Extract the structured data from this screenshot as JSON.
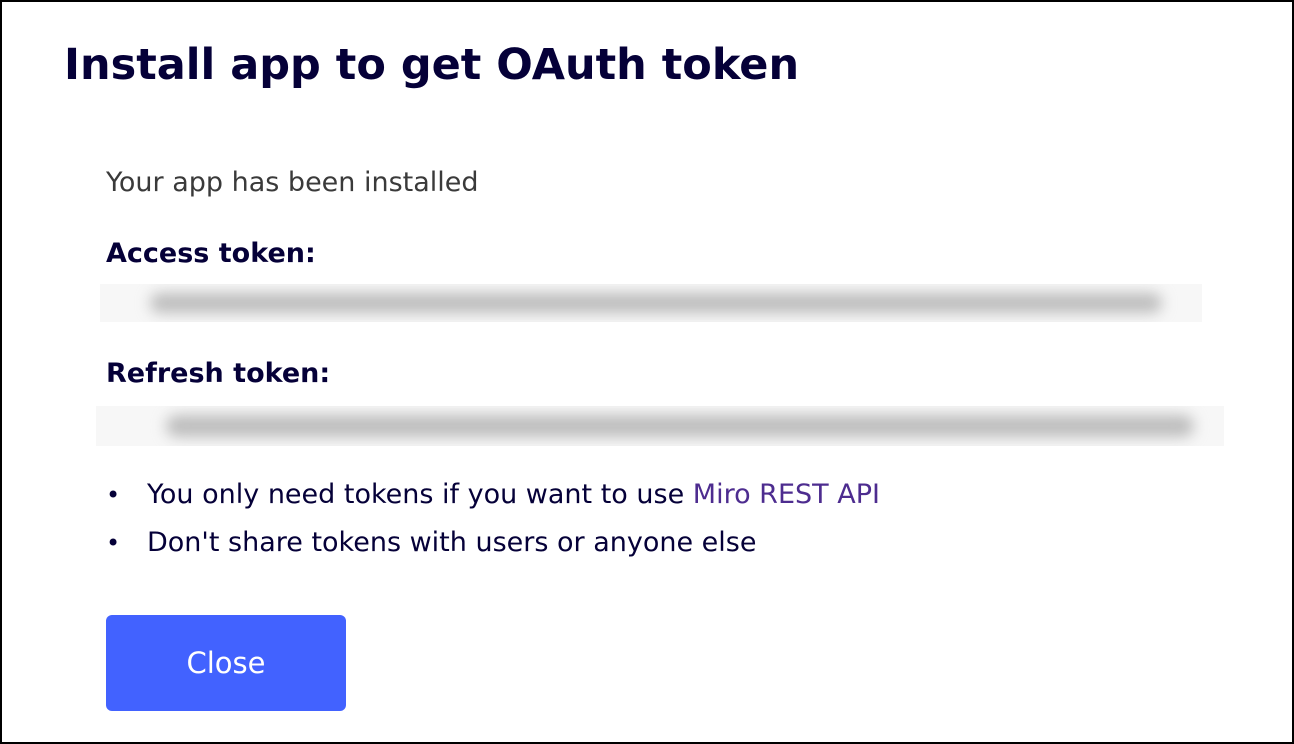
{
  "dialog": {
    "title": "Install app to get OAuth token",
    "status": "Your app has been installed",
    "access_token_label": "Access token:",
    "refresh_token_label": "Refresh token:",
    "notes": [
      {
        "bullet": "•",
        "text": "You only need tokens if you want to use ",
        "link_text": "Miro REST API"
      },
      {
        "bullet": "•",
        "text": "Don't share tokens with users or anyone else"
      }
    ],
    "close_label": "Close"
  },
  "colors": {
    "title": "#050038",
    "link": "#4d2c8f",
    "primary_button": "#4262ff",
    "border": "#000000"
  }
}
